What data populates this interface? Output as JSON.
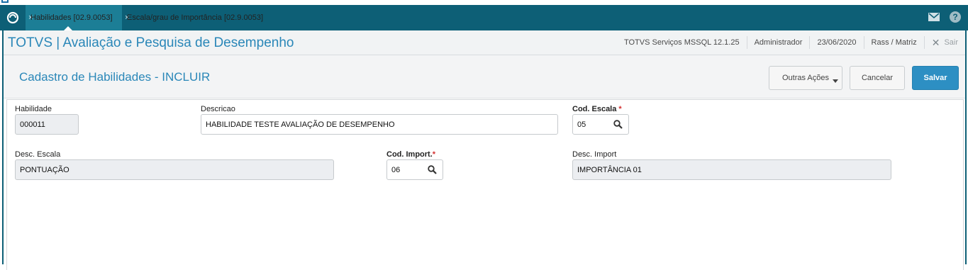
{
  "tabs": [
    {
      "label": "Habilidades [02.9.0053]",
      "active": true
    },
    {
      "label": "Escala/grau de Importância [02.9.0053]",
      "active": false
    }
  ],
  "app": {
    "title": "TOTVS | Avaliação e Pesquisa de Desempenho",
    "environment": "TOTVS Serviços MSSQL 12.1.25",
    "user": "Administrador",
    "date": "23/06/2020",
    "branch": "Rass / Matriz",
    "exit_label": "Sair"
  },
  "page": {
    "title": "Cadastro de Habilidades - INCLUIR",
    "actions": {
      "more": "Outras Ações",
      "cancel": "Cancelar",
      "save": "Salvar"
    }
  },
  "form": {
    "habilidade": {
      "label": "Habilidade",
      "value": "000011"
    },
    "descricao": {
      "label": "Descricao",
      "value": "HABILIDADE TESTE AVALIAÇÃO DE DESEMPENHO"
    },
    "cod_escala": {
      "label": "Cod. Escala",
      "required_mark": "*",
      "value": "05"
    },
    "desc_escala": {
      "label": "Desc. Escala",
      "value": "PONTUAÇÃO"
    },
    "cod_import": {
      "label": "Cod. Import.",
      "required_mark": "*",
      "value": "06"
    },
    "desc_import": {
      "label": "Desc. Import",
      "value": "IMPORTÂNCIA 01"
    }
  },
  "colors": {
    "tabbar": "#0d5f76",
    "accent": "#2a87b8",
    "primary_button": "#2d8fc3",
    "required": "#d32f2f"
  },
  "icons": [
    "app-logo-icon",
    "close-icon",
    "mail-icon",
    "help-icon",
    "search-icon"
  ]
}
